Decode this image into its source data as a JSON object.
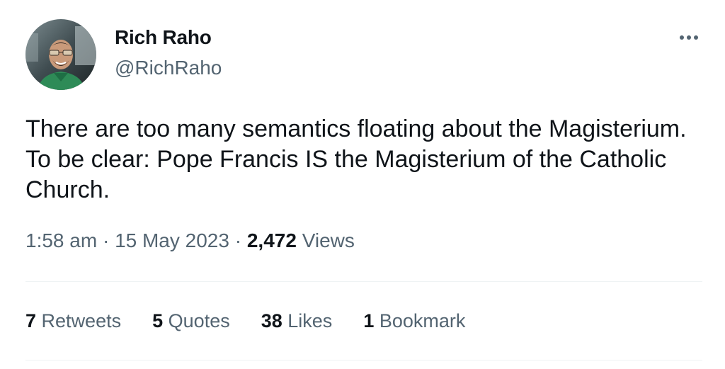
{
  "author": {
    "name": "Rich Raho",
    "handle": "@RichRaho"
  },
  "icons": {
    "avatar": "avatar-photo",
    "more": "more-options-icon"
  },
  "tweet": {
    "text": "There are too many semantics floating about the Magisterium. To be clear: Pope Francis IS the Magisterium of the Catholic Church."
  },
  "meta": {
    "time": "1:58 am",
    "separator1": "·",
    "date": "15 May 2023",
    "separator2": "·",
    "views_count": "2,472",
    "views_label": "Views"
  },
  "stats": [
    {
      "count": "7",
      "label": "Retweets"
    },
    {
      "count": "5",
      "label": "Quotes"
    },
    {
      "count": "38",
      "label": "Likes"
    },
    {
      "count": "1",
      "label": "Bookmark"
    }
  ],
  "colors": {
    "text_primary": "#0f1419",
    "text_secondary": "#536471",
    "divider": "#eff3f4",
    "avatar_bg": "#4a5a5f",
    "shirt": "#2e8b57"
  }
}
